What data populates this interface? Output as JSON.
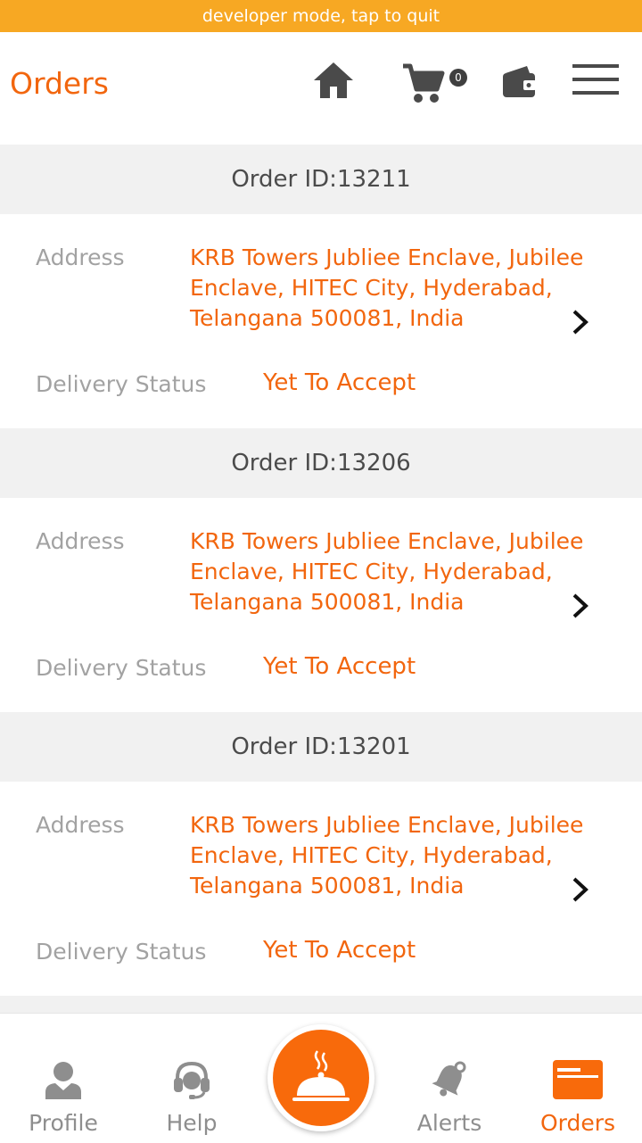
{
  "dev_banner": "developer mode, tap to quit",
  "header": {
    "title": "Orders",
    "cart_count": "0",
    "icons": [
      "home-icon",
      "cart-icon",
      "wallet-icon",
      "menu-icon"
    ]
  },
  "labels": {
    "address": "Address",
    "delivery_status": "Delivery Status"
  },
  "orders": [
    {
      "id_text": "Order ID:13211",
      "address": "KRB Towers Jubliee Enclave, Jubilee Enclave, HITEC City, Hyderabad, Telangana 500081, India",
      "status": "Yet To Accept"
    },
    {
      "id_text": "Order ID:13206",
      "address": "KRB Towers Jubliee Enclave, Jubilee Enclave, HITEC City, Hyderabad, Telangana 500081, India",
      "status": "Yet To Accept"
    },
    {
      "id_text": "Order ID:13201",
      "address": "KRB Towers Jubliee Enclave, Jubilee Enclave, HITEC City, Hyderabad, Telangana 500081, India",
      "status": "Yet To Accept"
    }
  ],
  "bottom_nav": {
    "profile": "Profile",
    "help": "Help",
    "alerts": "Alerts",
    "orders": "Orders",
    "center_icon": "cloche-icon"
  },
  "colors": {
    "accent": "#f2660e",
    "dev_banner": "#f7a823",
    "icon_gray": "#4a4a4a"
  }
}
